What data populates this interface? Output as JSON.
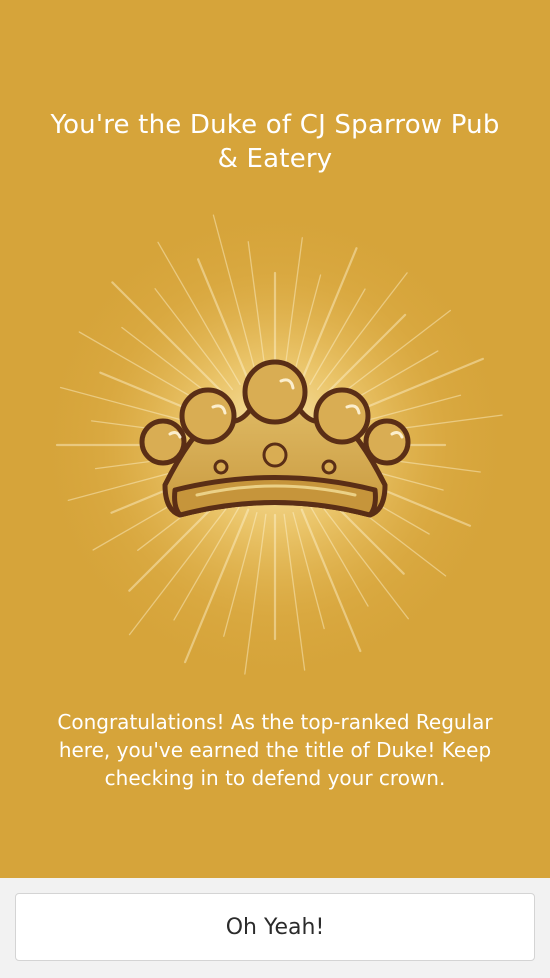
{
  "dialog": {
    "title": "You're the Duke of CJ Sparrow Pub & Eatery",
    "message": "Congratulations! As the top-ranked Regular here, you've earned the title of Duke! Keep checking in to defend your crown.",
    "badge_icon": "crown-icon",
    "background_color": "#d6a43a"
  },
  "footer": {
    "confirm_label": "Oh Yeah!"
  }
}
